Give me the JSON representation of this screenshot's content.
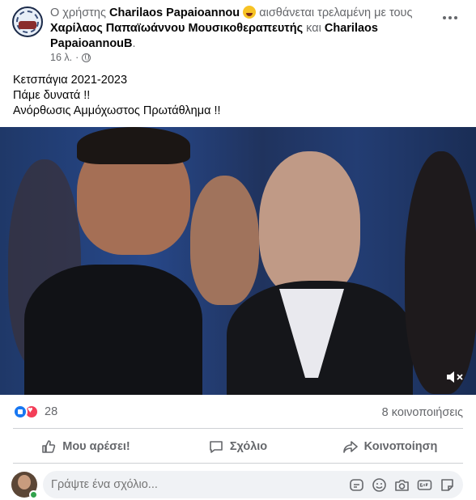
{
  "post": {
    "headline": {
      "prefix": "Ο χρήστης",
      "author": "Charilaos Papaioannou",
      "feeling": "αισθάνεται τρελαμένη με τους",
      "tag1": "Χαρίλαος Παπαϊωάννου Μουσικοθεραπευτής",
      "conj": "και",
      "tag2": "Charilaos PapaioannouB",
      "period": "."
    },
    "time": "16 λ.",
    "separator": "·",
    "text_lines": [
      "Κετσπάγια 2021-2023",
      "Πάμε δυνατά !!",
      "Ανόρθωσις Αμμόχωστος Πρωτάθλημα !!"
    ]
  },
  "stats": {
    "reaction_count": "28",
    "shares": "8 κοινοποιήσεις"
  },
  "actions": {
    "like": "Μου αρέσει!",
    "comment": "Σχόλιο",
    "share": "Κοινοποίηση"
  },
  "comment_box": {
    "placeholder": "Γράψτε ένα σχόλιο..."
  },
  "icons": [
    "more-icon",
    "globe-icon",
    "mute-icon",
    "like-reaction-icon",
    "love-reaction-icon",
    "thumbs-up-icon",
    "comment-icon",
    "share-icon",
    "sticker-icon",
    "emoji-icon",
    "camera-icon",
    "gif-icon",
    "sticker-pack-icon"
  ],
  "colors": {
    "accent": "#1877f2",
    "love": "#f33e58",
    "secondary_text": "#65676b",
    "online": "#31a24c"
  }
}
